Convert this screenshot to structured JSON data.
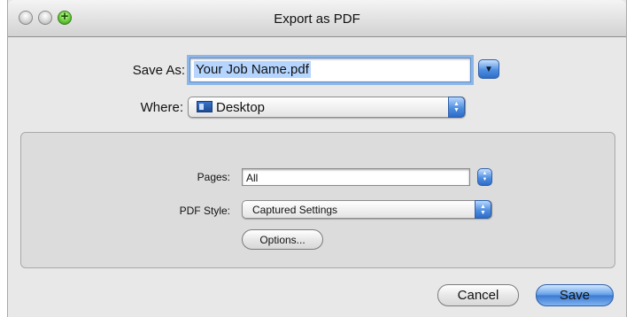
{
  "window": {
    "title": "Export as PDF"
  },
  "save": {
    "label": "Save As:",
    "filename": "Your Job Name.pdf"
  },
  "where": {
    "label": "Where:",
    "value": "Desktop"
  },
  "settings": {
    "pages_label": "Pages:",
    "pages_value": "All",
    "pdf_style_label": "PDF Style:",
    "pdf_style_value": "Captured Settings",
    "options_button": "Options..."
  },
  "buttons": {
    "cancel": "Cancel",
    "save": "Save"
  },
  "icons": {
    "close": "close-icon",
    "minimize": "minimize-icon",
    "zoom": "zoom-icon",
    "expand": "disclosure-down-icon",
    "folder": "desktop-folder-icon",
    "stepper": "popup-arrows-icon"
  }
}
